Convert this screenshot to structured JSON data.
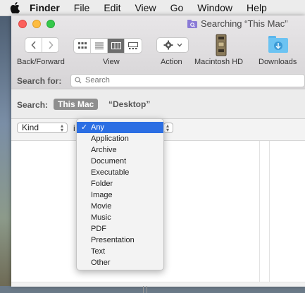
{
  "menubar": {
    "items": [
      "Finder",
      "File",
      "Edit",
      "View",
      "Go",
      "Window",
      "Help"
    ]
  },
  "window": {
    "title": "Searching “This Mac”"
  },
  "toolbar": {
    "back_forward_label": "Back/Forward",
    "view_label": "View",
    "action_label": "Action",
    "macintosh_label": "Macintosh HD",
    "downloads_label": "Downloads"
  },
  "search": {
    "label": "Search for:",
    "placeholder": "Search"
  },
  "scope": {
    "label": "Search:",
    "this_mac": "This Mac",
    "desktop": "“Desktop”"
  },
  "criteria": {
    "attribute": "Kind",
    "operator_prefix": "i"
  },
  "dropdown": {
    "check": "✓",
    "options": [
      "Any",
      "Application",
      "Archive",
      "Document",
      "Executable",
      "Folder",
      "Image",
      "Movie",
      "Music",
      "PDF",
      "Presentation",
      "Text",
      "Other"
    ]
  },
  "colors": {
    "selection": "#2b6ee3",
    "scope_token": "#8e8e8e"
  },
  "icons": [
    "apple-icon",
    "folder-search-icon",
    "chevron-left-icon",
    "chevron-right-icon",
    "icon-view-icon",
    "list-view-icon",
    "column-view-icon",
    "gallery-view-icon",
    "gear-icon",
    "chevron-down-icon",
    "hard-drive-icon",
    "downloads-folder-icon",
    "magnifier-icon"
  ]
}
